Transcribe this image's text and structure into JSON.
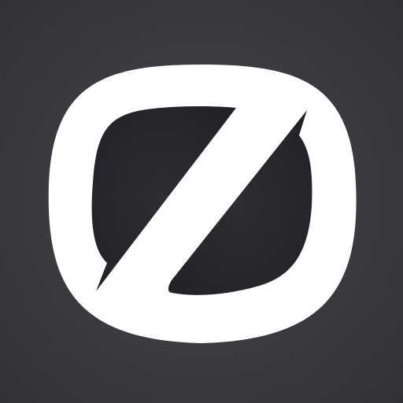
{
  "app_icon": {
    "icon": "slashed-o-logo-icon",
    "colors": {
      "background": "#3b3a3f",
      "glyph": "#ffffff",
      "inner_dark": "#2b2a2f"
    }
  }
}
